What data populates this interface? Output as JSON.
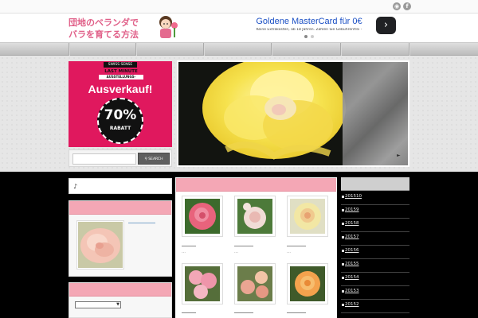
{
  "site": {
    "logo_line1": "団地のベランダで",
    "logo_line2": "バラを育てる方法"
  },
  "header_social": [
    "rss-icon",
    "facebook-icon"
  ],
  "ad_banner": {
    "title": "Goldene MasterCard für 0€",
    "subtitle": "Keine Extrakosten, ab 18 Jahren. Zahlen Sie Gebührenfrei -",
    "arrow": "›"
  },
  "sale_ad": {
    "brand": "SWISS SENSE",
    "last_minute": "LAST MINUTE",
    "strip": "AUSSTELLUNGS-",
    "headline": "Ausverkauf!",
    "percent": "70%",
    "rabatt": "RABATT"
  },
  "search": {
    "placeholder": "",
    "button_label": "SEARCH"
  },
  "music_widget": {
    "note": "♪"
  },
  "sidebar_archive": {
    "items": [
      "201510",
      "20159",
      "20158",
      "20157",
      "20156",
      "20155",
      "20154",
      "20153",
      "20152"
    ]
  },
  "colors": {
    "accent_pink": "#f4a7b5",
    "ad_pink": "#e0185e",
    "content_bg": "#000000"
  }
}
